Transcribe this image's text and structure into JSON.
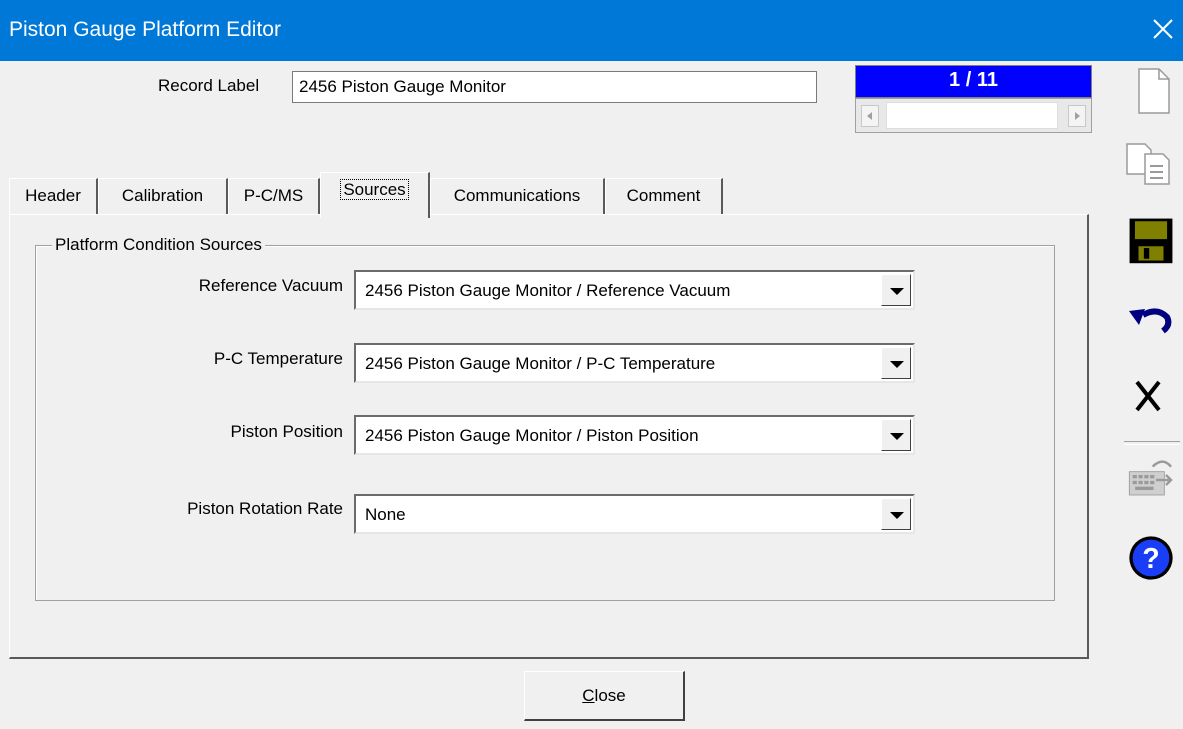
{
  "window": {
    "title": "Piston Gauge Platform Editor"
  },
  "record": {
    "label_caption": "Record Label",
    "label_value": "2456 Piston Gauge Monitor",
    "counter": "1 / 11"
  },
  "tabs": [
    "Header",
    "Calibration",
    "P-C/MS",
    "Sources",
    "Communications",
    "Comment"
  ],
  "active_tab": "Sources",
  "group": {
    "title": "Platform Condition Sources",
    "rows": [
      {
        "label": "Reference Vacuum",
        "value": "2456 Piston Gauge Monitor / Reference Vacuum"
      },
      {
        "label": "P-C Temperature",
        "value": "2456 Piston Gauge Monitor / P-C Temperature"
      },
      {
        "label": "Piston Position",
        "value": "2456 Piston Gauge Monitor / Piston Position"
      },
      {
        "label": "Piston Rotation Rate",
        "value": "None"
      }
    ]
  },
  "toolbar": {
    "icons": [
      "new-document-icon",
      "copy-icon",
      "save-icon",
      "undo-icon",
      "delete-icon",
      "keyboard-disabled-icon",
      "help-icon"
    ]
  },
  "footer": {
    "close_label": "Close"
  },
  "colors": {
    "titlebar": "#0078d7",
    "counter_bg": "#0000ff",
    "save_icon": "#808000"
  }
}
